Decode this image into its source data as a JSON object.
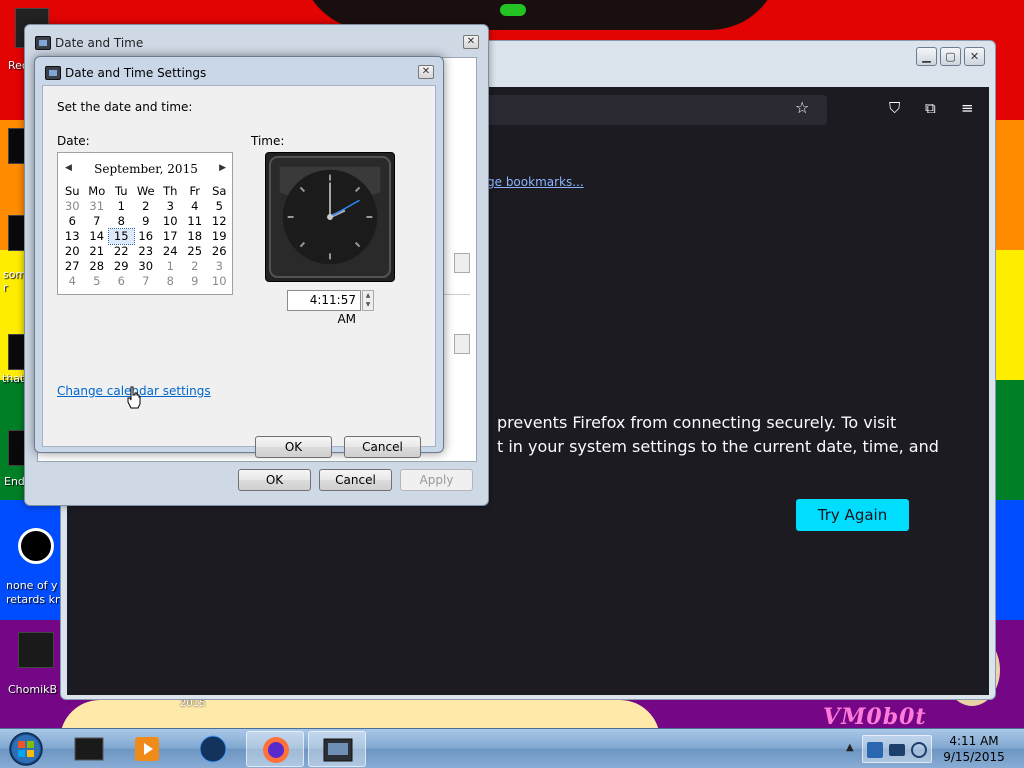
{
  "desktop": {
    "icons": [
      {
        "label": "Rec"
      },
      {
        "label": "som r"
      },
      {
        "label": "that"
      },
      {
        "label": "End"
      },
      {
        "label": "none of y retards kn"
      },
      {
        "label": "ChomikB"
      }
    ],
    "wall_year": "2015",
    "watermark": "VM0b0t"
  },
  "firefox": {
    "bookmarks_link": "ge bookmarks...",
    "error_line_1": "prevents Firefox from connecting securely. To visit",
    "error_line_2": "t in your system settings to the current date, time, and",
    "try_again_button": "Try Again"
  },
  "outer_window": {
    "title": "Date and Time",
    "ok_button": "OK",
    "cancel_button": "Cancel",
    "apply_button": "Apply"
  },
  "inner_dialog": {
    "title": "Date and Time Settings",
    "instruction": "Set the date and time:",
    "date_label": "Date:",
    "time_label": "Time:",
    "calendar": {
      "month_title": "September, 2015",
      "weekdays": [
        "Su",
        "Mo",
        "Tu",
        "We",
        "Th",
        "Fr",
        "Sa"
      ],
      "weeks": [
        [
          "30",
          "31",
          "1",
          "2",
          "3",
          "4",
          "5"
        ],
        [
          "6",
          "7",
          "8",
          "9",
          "10",
          "11",
          "12"
        ],
        [
          "13",
          "14",
          "15",
          "16",
          "17",
          "18",
          "19"
        ],
        [
          "20",
          "21",
          "22",
          "23",
          "24",
          "25",
          "26"
        ],
        [
          "27",
          "28",
          "29",
          "30",
          "1",
          "2",
          "3"
        ],
        [
          "4",
          "5",
          "6",
          "7",
          "8",
          "9",
          "10"
        ]
      ],
      "selected_day": "15"
    },
    "time_value": "4:11:57 AM",
    "change_calendar_link": "Change calendar settings",
    "ok_button": "OK",
    "cancel_button": "Cancel"
  },
  "taskbar": {
    "clock_time": "4:11 AM",
    "clock_date": "9/15/2015"
  },
  "colors": {
    "try_again": "#00ddff",
    "link": "#0066cc",
    "firefox_bg": "#1c1b22"
  }
}
